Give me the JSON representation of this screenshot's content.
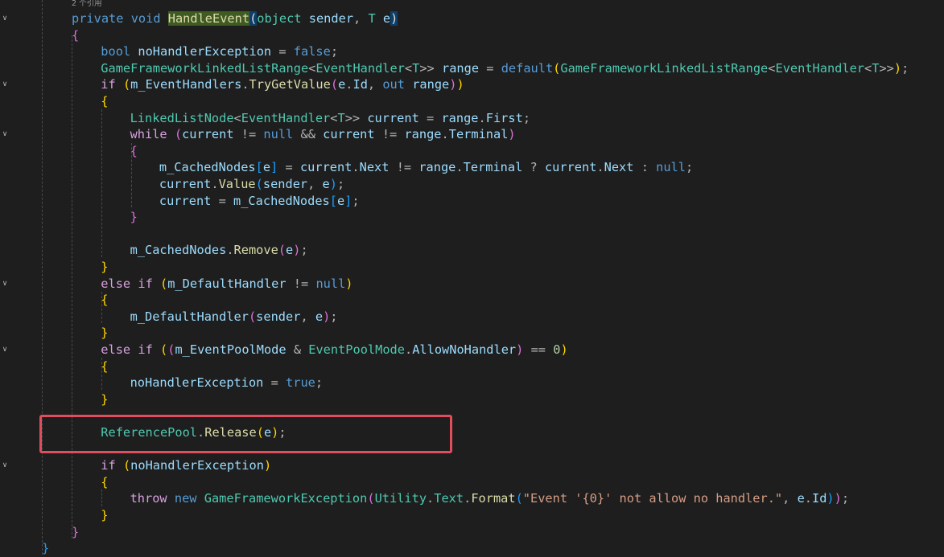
{
  "editor": {
    "codelens": "2 个引用",
    "highlight_color": "#e04e5e",
    "lines": [
      {
        "fold": "v",
        "indent": 0,
        "tokens": [
          [
            "kw",
            "private"
          ],
          [
            "t",
            " "
          ],
          [
            "kw",
            "void"
          ],
          [
            "t",
            " "
          ],
          [
            "hl",
            "HandleEvent"
          ],
          [
            "hlp",
            "("
          ],
          [
            "ty",
            "object"
          ],
          [
            "t",
            " "
          ],
          [
            "id",
            "sender"
          ],
          [
            "pu",
            ", "
          ],
          [
            "ty",
            "T"
          ],
          [
            "t",
            " "
          ],
          [
            "id",
            "e"
          ],
          [
            "hlp",
            ")"
          ]
        ]
      },
      {
        "fold": "",
        "indent": 0,
        "tokens": [
          [
            "p2",
            "{"
          ]
        ]
      },
      {
        "fold": "",
        "indent": 1,
        "tokens": [
          [
            "kw",
            "bool"
          ],
          [
            "t",
            " "
          ],
          [
            "id",
            "noHandlerException"
          ],
          [
            "t",
            " "
          ],
          [
            "op",
            "="
          ],
          [
            "t",
            " "
          ],
          [
            "kw",
            "false"
          ],
          [
            "pu",
            ";"
          ]
        ]
      },
      {
        "fold": "",
        "indent": 1,
        "tokens": [
          [
            "ty",
            "GameFrameworkLinkedListRange"
          ],
          [
            "op",
            "<"
          ],
          [
            "ty",
            "EventHandler"
          ],
          [
            "op",
            "<"
          ],
          [
            "ty",
            "T"
          ],
          [
            "op",
            ">>"
          ],
          [
            "t",
            " "
          ],
          [
            "id",
            "range"
          ],
          [
            "t",
            " "
          ],
          [
            "op",
            "="
          ],
          [
            "t",
            " "
          ],
          [
            "kw",
            "default"
          ],
          [
            "p1",
            "("
          ],
          [
            "ty",
            "GameFrameworkLinkedListRange"
          ],
          [
            "op",
            "<"
          ],
          [
            "ty",
            "EventHandler"
          ],
          [
            "op",
            "<"
          ],
          [
            "ty",
            "T"
          ],
          [
            "op",
            ">>"
          ],
          [
            "p1",
            ")"
          ],
          [
            "pu",
            ";"
          ]
        ]
      },
      {
        "fold": "v",
        "indent": 1,
        "tokens": [
          [
            "ctl",
            "if"
          ],
          [
            "t",
            " "
          ],
          [
            "p1",
            "("
          ],
          [
            "id",
            "m_EventHandlers"
          ],
          [
            "pu",
            "."
          ],
          [
            "fn",
            "TryGetValue"
          ],
          [
            "p2",
            "("
          ],
          [
            "id",
            "e"
          ],
          [
            "pu",
            "."
          ],
          [
            "id",
            "Id"
          ],
          [
            "pu",
            ", "
          ],
          [
            "kw",
            "out"
          ],
          [
            "t",
            " "
          ],
          [
            "id",
            "range"
          ],
          [
            "p2",
            ")"
          ],
          [
            "p1",
            ")"
          ]
        ]
      },
      {
        "fold": "",
        "indent": 1,
        "tokens": [
          [
            "p1",
            "{"
          ]
        ]
      },
      {
        "fold": "",
        "indent": 2,
        "tokens": [
          [
            "ty",
            "LinkedListNode"
          ],
          [
            "op",
            "<"
          ],
          [
            "ty",
            "EventHandler"
          ],
          [
            "op",
            "<"
          ],
          [
            "ty",
            "T"
          ],
          [
            "op",
            ">>"
          ],
          [
            "t",
            " "
          ],
          [
            "id",
            "current"
          ],
          [
            "t",
            " "
          ],
          [
            "op",
            "="
          ],
          [
            "t",
            " "
          ],
          [
            "id",
            "range"
          ],
          [
            "pu",
            "."
          ],
          [
            "id",
            "First"
          ],
          [
            "pu",
            ";"
          ]
        ]
      },
      {
        "fold": "v",
        "indent": 2,
        "tokens": [
          [
            "ctl",
            "while"
          ],
          [
            "t",
            " "
          ],
          [
            "p2",
            "("
          ],
          [
            "id",
            "current"
          ],
          [
            "t",
            " "
          ],
          [
            "op",
            "!="
          ],
          [
            "t",
            " "
          ],
          [
            "kw",
            "null"
          ],
          [
            "t",
            " "
          ],
          [
            "op",
            "&&"
          ],
          [
            "t",
            " "
          ],
          [
            "id",
            "current"
          ],
          [
            "t",
            " "
          ],
          [
            "op",
            "!="
          ],
          [
            "t",
            " "
          ],
          [
            "id",
            "range"
          ],
          [
            "pu",
            "."
          ],
          [
            "id",
            "Terminal"
          ],
          [
            "p2",
            ")"
          ]
        ]
      },
      {
        "fold": "",
        "indent": 2,
        "tokens": [
          [
            "p2",
            "{"
          ]
        ]
      },
      {
        "fold": "",
        "indent": 3,
        "tokens": [
          [
            "id",
            "m_CachedNodes"
          ],
          [
            "p3",
            "["
          ],
          [
            "id",
            "e"
          ],
          [
            "p3",
            "]"
          ],
          [
            "t",
            " "
          ],
          [
            "op",
            "="
          ],
          [
            "t",
            " "
          ],
          [
            "id",
            "current"
          ],
          [
            "pu",
            "."
          ],
          [
            "id",
            "Next"
          ],
          [
            "t",
            " "
          ],
          [
            "op",
            "!="
          ],
          [
            "t",
            " "
          ],
          [
            "id",
            "range"
          ],
          [
            "pu",
            "."
          ],
          [
            "id",
            "Terminal"
          ],
          [
            "t",
            " "
          ],
          [
            "op",
            "?"
          ],
          [
            "t",
            " "
          ],
          [
            "id",
            "current"
          ],
          [
            "pu",
            "."
          ],
          [
            "id",
            "Next"
          ],
          [
            "t",
            " "
          ],
          [
            "op",
            ":"
          ],
          [
            "t",
            " "
          ],
          [
            "kw",
            "null"
          ],
          [
            "pu",
            ";"
          ]
        ]
      },
      {
        "fold": "",
        "indent": 3,
        "tokens": [
          [
            "id",
            "current"
          ],
          [
            "pu",
            "."
          ],
          [
            "fn",
            "Value"
          ],
          [
            "p3",
            "("
          ],
          [
            "id",
            "sender"
          ],
          [
            "pu",
            ", "
          ],
          [
            "id",
            "e"
          ],
          [
            "p3",
            ")"
          ],
          [
            "pu",
            ";"
          ]
        ]
      },
      {
        "fold": "",
        "indent": 3,
        "tokens": [
          [
            "id",
            "current"
          ],
          [
            "t",
            " "
          ],
          [
            "op",
            "="
          ],
          [
            "t",
            " "
          ],
          [
            "id",
            "m_CachedNodes"
          ],
          [
            "p3",
            "["
          ],
          [
            "id",
            "e"
          ],
          [
            "p3",
            "]"
          ],
          [
            "pu",
            ";"
          ]
        ]
      },
      {
        "fold": "",
        "indent": 2,
        "tokens": [
          [
            "p2",
            "}"
          ]
        ]
      },
      {
        "fold": "",
        "indent": 2,
        "tokens": []
      },
      {
        "fold": "",
        "indent": 2,
        "tokens": [
          [
            "id",
            "m_CachedNodes"
          ],
          [
            "pu",
            "."
          ],
          [
            "fn",
            "Remove"
          ],
          [
            "p2",
            "("
          ],
          [
            "id",
            "e"
          ],
          [
            "p2",
            ")"
          ],
          [
            "pu",
            ";"
          ]
        ]
      },
      {
        "fold": "",
        "indent": 1,
        "tokens": [
          [
            "p1",
            "}"
          ]
        ]
      },
      {
        "fold": "v",
        "indent": 1,
        "tokens": [
          [
            "ctl",
            "else"
          ],
          [
            "t",
            " "
          ],
          [
            "ctl",
            "if"
          ],
          [
            "t",
            " "
          ],
          [
            "p1",
            "("
          ],
          [
            "id",
            "m_DefaultHandler"
          ],
          [
            "t",
            " "
          ],
          [
            "op",
            "!="
          ],
          [
            "t",
            " "
          ],
          [
            "kw",
            "null"
          ],
          [
            "p1",
            ")"
          ]
        ]
      },
      {
        "fold": "",
        "indent": 1,
        "tokens": [
          [
            "p1",
            "{"
          ]
        ]
      },
      {
        "fold": "",
        "indent": 2,
        "tokens": [
          [
            "id",
            "m_DefaultHandler"
          ],
          [
            "p2",
            "("
          ],
          [
            "id",
            "sender"
          ],
          [
            "pu",
            ", "
          ],
          [
            "id",
            "e"
          ],
          [
            "p2",
            ")"
          ],
          [
            "pu",
            ";"
          ]
        ]
      },
      {
        "fold": "",
        "indent": 1,
        "tokens": [
          [
            "p1",
            "}"
          ]
        ]
      },
      {
        "fold": "v",
        "indent": 1,
        "tokens": [
          [
            "ctl",
            "else"
          ],
          [
            "t",
            " "
          ],
          [
            "ctl",
            "if"
          ],
          [
            "t",
            " "
          ],
          [
            "p1",
            "("
          ],
          [
            "p2",
            "("
          ],
          [
            "id",
            "m_EventPoolMode"
          ],
          [
            "t",
            " "
          ],
          [
            "op",
            "&"
          ],
          [
            "t",
            " "
          ],
          [
            "ty",
            "EventPoolMode"
          ],
          [
            "pu",
            "."
          ],
          [
            "id",
            "AllowNoHandler"
          ],
          [
            "p2",
            ")"
          ],
          [
            "t",
            " "
          ],
          [
            "op",
            "=="
          ],
          [
            "t",
            " "
          ],
          [
            "num",
            "0"
          ],
          [
            "p1",
            ")"
          ]
        ]
      },
      {
        "fold": "",
        "indent": 1,
        "tokens": [
          [
            "p1",
            "{"
          ]
        ]
      },
      {
        "fold": "",
        "indent": 2,
        "tokens": [
          [
            "id",
            "noHandlerException"
          ],
          [
            "t",
            " "
          ],
          [
            "op",
            "="
          ],
          [
            "t",
            " "
          ],
          [
            "kw",
            "true"
          ],
          [
            "pu",
            ";"
          ]
        ]
      },
      {
        "fold": "",
        "indent": 1,
        "tokens": [
          [
            "p1",
            "}"
          ]
        ]
      },
      {
        "fold": "",
        "indent": 1,
        "tokens": []
      },
      {
        "fold": "",
        "indent": 1,
        "tokens": [
          [
            "ty",
            "ReferencePool"
          ],
          [
            "pu",
            "."
          ],
          [
            "fn",
            "Release"
          ],
          [
            "p1",
            "("
          ],
          [
            "id",
            "e"
          ],
          [
            "p1",
            ")"
          ],
          [
            "pu",
            ";"
          ]
        ]
      },
      {
        "fold": "",
        "indent": 1,
        "tokens": []
      },
      {
        "fold": "v",
        "indent": 1,
        "tokens": [
          [
            "ctl",
            "if"
          ],
          [
            "t",
            " "
          ],
          [
            "p1",
            "("
          ],
          [
            "id",
            "noHandlerException"
          ],
          [
            "p1",
            ")"
          ]
        ]
      },
      {
        "fold": "",
        "indent": 1,
        "tokens": [
          [
            "p1",
            "{"
          ]
        ]
      },
      {
        "fold": "",
        "indent": 2,
        "tokens": [
          [
            "ctl",
            "throw"
          ],
          [
            "t",
            " "
          ],
          [
            "kw",
            "new"
          ],
          [
            "t",
            " "
          ],
          [
            "ty",
            "GameFrameworkException"
          ],
          [
            "p2",
            "("
          ],
          [
            "ty",
            "Utility"
          ],
          [
            "pu",
            "."
          ],
          [
            "ty",
            "Text"
          ],
          [
            "pu",
            "."
          ],
          [
            "fn",
            "Format"
          ],
          [
            "p3",
            "("
          ],
          [
            "str",
            "\"Event '{0}' not allow no handler.\""
          ],
          [
            "pu",
            ", "
          ],
          [
            "id",
            "e"
          ],
          [
            "pu",
            "."
          ],
          [
            "id",
            "Id"
          ],
          [
            "p3",
            ")"
          ],
          [
            "p2",
            ")"
          ],
          [
            "pu",
            ";"
          ]
        ]
      },
      {
        "fold": "",
        "indent": 1,
        "tokens": [
          [
            "p1",
            "}"
          ]
        ]
      },
      {
        "fold": "",
        "indent": 0,
        "tokens": [
          [
            "p2",
            "}"
          ]
        ]
      },
      {
        "fold": "",
        "indent": -1,
        "tokens": [
          [
            "p3",
            "}"
          ]
        ]
      }
    ]
  }
}
